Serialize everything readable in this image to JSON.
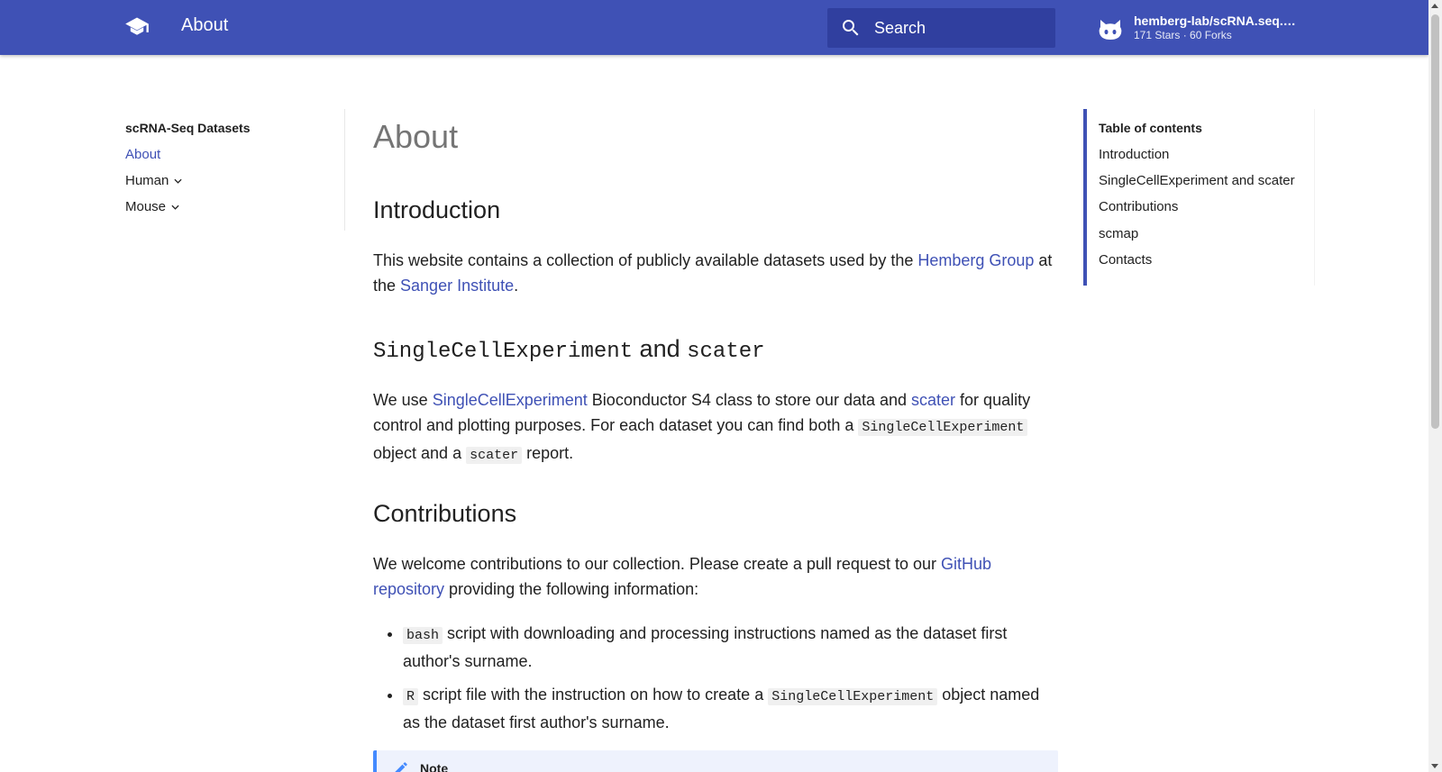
{
  "header": {
    "title": "About",
    "logo_icon": "graduation-cap-icon",
    "search_placeholder": "Search",
    "repo": {
      "name": "hemberg-lab/scRNA.seq.d...",
      "stats": "171 Stars · 60 Forks",
      "icon": "github-icon"
    }
  },
  "nav": {
    "title": "scRNA-Seq Datasets",
    "items": [
      {
        "label": "About",
        "active": true
      },
      {
        "label": "Human"
      },
      {
        "label": "Mouse"
      }
    ]
  },
  "content": {
    "title": "About",
    "intro": {
      "heading": "Introduction",
      "text1": "This website contains a collection of publicly available datasets used by the ",
      "link1": "Hemberg Group",
      "text2": " at the ",
      "link2": "Sanger Institute",
      "text3": "."
    },
    "sce": {
      "heading_code1": "SingleCellExperiment",
      "heading_and": " and ",
      "heading_code2": "scater",
      "text1": "We use ",
      "link1": "SingleCellExperiment",
      "text2": " Bioconductor S4 class to store our data and ",
      "link2": "scater",
      "text3": " for quality control and plotting purposes. For each dataset you can find both a ",
      "code1": "SingleCellExperiment",
      "text4": " object and a ",
      "code2": "scater",
      "text5": " report."
    },
    "contrib": {
      "heading": "Contributions",
      "text1": "We welcome contributions to our collection. Please create a pull request to our ",
      "link1": "GitHub repository",
      "text2": " providing the following information:",
      "item1_code": "bash",
      "item1_text": " script with downloading and processing instructions named as the dataset first author's surname.",
      "item2_code": "R",
      "item2_text1": " script file with the instruction on how to create a ",
      "item2_code2": "SingleCellExperiment",
      "item2_text2": " object named as the dataset first author's surname."
    },
    "note": {
      "title": "Note",
      "icon": "pencil-icon"
    }
  },
  "toc": {
    "title": "Table of contents",
    "items": [
      "Introduction",
      "SingleCellExperiment and scater",
      "Contributions",
      "scmap",
      "Contacts"
    ]
  },
  "colors": {
    "primary": "#3f51b5",
    "search_bg": "#303f9f",
    "note_accent": "#448aff"
  }
}
